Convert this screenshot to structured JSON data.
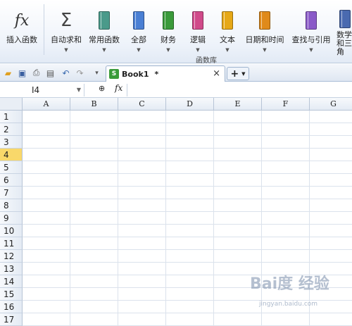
{
  "ribbon": {
    "buttons": [
      {
        "label": "插入函数",
        "icon": "fx-icon",
        "color": "#333333"
      },
      {
        "label": "自动求和",
        "icon": "sigma-icon",
        "color": "#444444"
      },
      {
        "label": "常用函数",
        "icon": "book-icon",
        "color": "#4a9a8a"
      },
      {
        "label": "全部",
        "icon": "book-icon",
        "color": "#4a7fd4"
      },
      {
        "label": "财务",
        "icon": "book-icon",
        "color": "#3a9a3a"
      },
      {
        "label": "逻辑",
        "icon": "book-icon",
        "color": "#d04a8a"
      },
      {
        "label": "文本",
        "icon": "book-icon",
        "color": "#e6a817"
      },
      {
        "label": "日期和时间",
        "icon": "book-icon",
        "color": "#e08a1a"
      },
      {
        "label": "查找与引用",
        "icon": "book-icon",
        "color": "#8a5ac8"
      },
      {
        "label": "数学和三角",
        "icon": "book-icon",
        "color": "#4a6ab0"
      }
    ],
    "group_label": "函数库",
    "sigma_glyph": "Σ",
    "fx_glyph": "fx"
  },
  "toolbar": {
    "tab_name": "Book1",
    "tab_modified": "*",
    "tab_close": "×",
    "new_tab": "+"
  },
  "formula_bar": {
    "name_box": "I4",
    "fx_label": "fx",
    "formula": ""
  },
  "grid": {
    "columns": [
      "A",
      "B",
      "C",
      "D",
      "E",
      "F",
      "G"
    ],
    "rows": [
      "1",
      "2",
      "3",
      "4",
      "5",
      "6",
      "7",
      "8",
      "9",
      "10",
      "11",
      "12",
      "13",
      "14",
      "15",
      "16",
      "17"
    ],
    "active_row": "4",
    "header_highlight_color": "#f9d86a"
  },
  "watermark": {
    "text": "Bai度 经验",
    "sub": "jingyan.baidu.com"
  }
}
